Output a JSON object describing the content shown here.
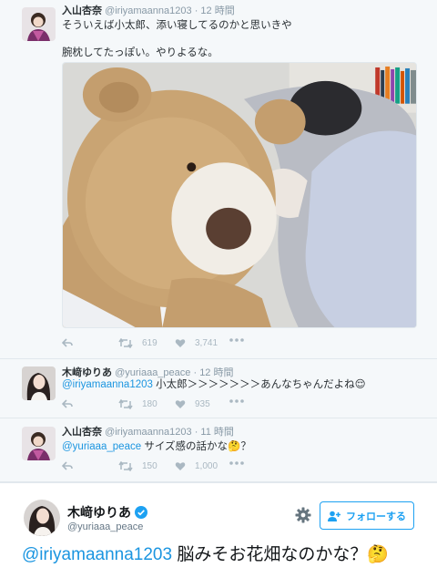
{
  "tweets": [
    {
      "name": "入山杏奈",
      "handle": "@iriyamaanna1203",
      "time": "· 12 時間",
      "line1": "そういえば小太郎、添い寝してるのかと思いきや",
      "line2": "腕枕してたっぽい。やりよるな。",
      "retweets": "619",
      "likes": "3,741"
    },
    {
      "name": "木﨑ゆりあ",
      "handle": "@yuriaaa_peace",
      "time": "· 12 時間",
      "mention": "@iriyamaanna1203",
      "text": " 小太郎＞＞＞＞＞＞＞あんなちゃんだよね",
      "emoji": "😌",
      "retweets": "180",
      "likes": "935"
    },
    {
      "name": "入山杏奈",
      "handle": "@iriyamaanna1203",
      "time": "· 11 時間",
      "mention": "@yuriaaa_peace",
      "text": " サイズ感の話かな",
      "emoji": "🤔",
      "suffix": "？",
      "retweets": "150",
      "likes": "1,000"
    }
  ],
  "main_tweet": {
    "name": "木﨑ゆりあ",
    "handle": "@yuriaaa_peace",
    "follow_label": "フォローする",
    "mention": "@iriyamaanna1203",
    "text": " 脳みそお花畑なのかな？",
    "emoji": "🤔"
  },
  "colors": {
    "link": "#1b95e0",
    "accent": "#1da1f2",
    "verified": "#1da1f2",
    "muted": "#8899a6"
  }
}
